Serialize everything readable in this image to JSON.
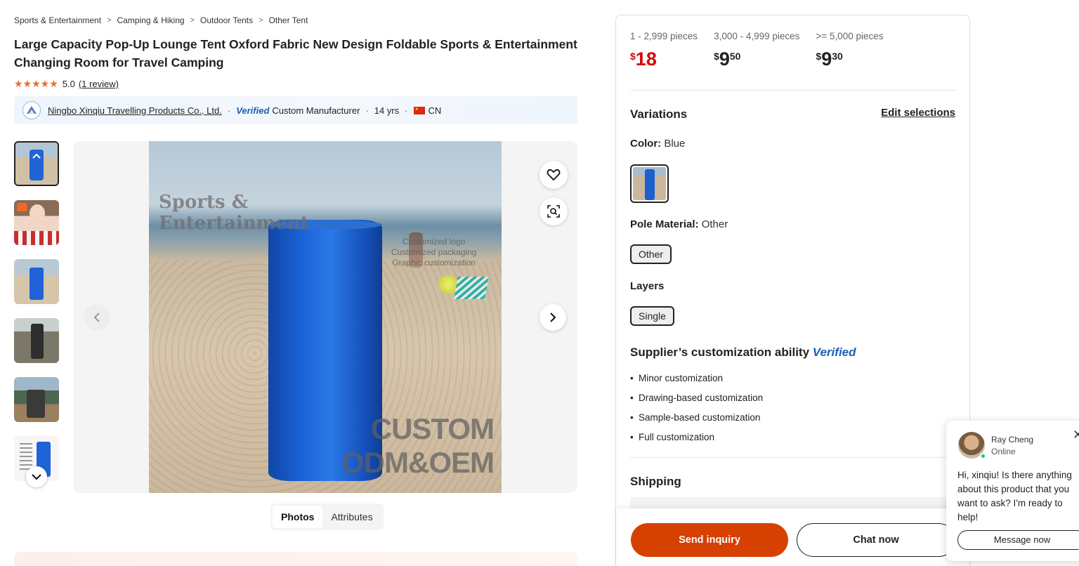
{
  "breadcrumb": [
    "Sports & Entertainment",
    "Camping & Hiking",
    "Outdoor Tents",
    "Other Tent"
  ],
  "product": {
    "title": "Large Capacity Pop-Up Lounge Tent Oxford Fabric New Design Foldable Sports & Entertainment Changing Room for Travel Camping",
    "rating": "5.0",
    "stars": "★★★★★",
    "reviews": "(1 review)"
  },
  "supplier": {
    "name": "Ningbo Xinqiu Travelling Products Co., Ltd.",
    "verified": "Verified",
    "type": "Custom Manufacturer",
    "years": "14 yrs",
    "country": "CN"
  },
  "image_watermarks": {
    "brand": "Sports &\nEntertainment",
    "services": "Customized logo\nCustomized packaging\nGraphic customization",
    "custom": "CUSTOM\nODM&OEM"
  },
  "tabs": [
    {
      "label": "Photos",
      "active": true
    },
    {
      "label": "Attributes",
      "active": false
    }
  ],
  "pricing": [
    {
      "qty": "1 - 2,999 pieces",
      "currency": "$",
      "int": "18",
      "dec": ""
    },
    {
      "qty": "3,000 - 4,999 pieces",
      "currency": "$",
      "int": "9",
      "dec": "50"
    },
    {
      "qty": ">= 5,000 pieces",
      "currency": "$",
      "int": "9",
      "dec": "30"
    }
  ],
  "variations": {
    "title": "Variations",
    "edit_label": "Edit selections",
    "color_label": "Color:",
    "color_value": "Blue",
    "pole_label": "Pole Material:",
    "pole_value": "Other",
    "pole_option": "Other",
    "layers_label": "Layers",
    "layers_option": "Single"
  },
  "customization": {
    "title": "Supplier’s customization ability",
    "verified": "Verified",
    "items": [
      "Minor customization",
      "Drawing-based customization",
      "Sample-based customization",
      "Full customization"
    ]
  },
  "shipping": {
    "title": "Shipping"
  },
  "actions": {
    "inquiry": "Send inquiry",
    "chat": "Chat now"
  },
  "chat": {
    "name": "Ray Cheng",
    "status": "Online",
    "message": "Hi, xinqiu! Is there anything about this product that you want to ask? I'm ready to help!",
    "button": "Message now"
  },
  "colors": {
    "price_red": "#d9000b",
    "accent": "#d64000",
    "verified": "#1a5fb4"
  }
}
